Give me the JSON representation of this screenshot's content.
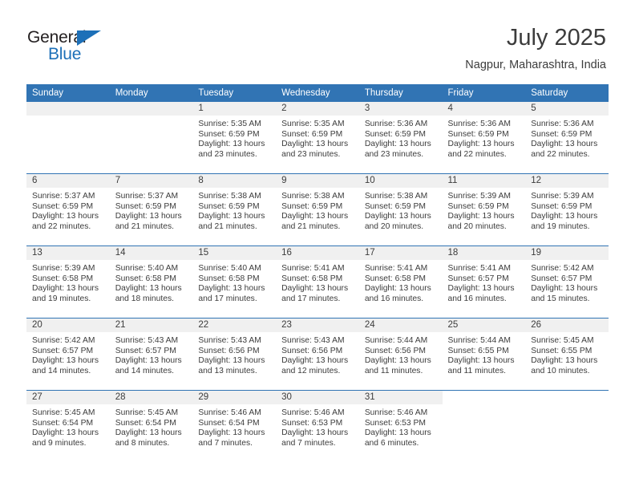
{
  "brand": {
    "name_part1": "General",
    "name_part2": "Blue",
    "triangle_color": "#1d70b8",
    "text_color": "#231f20"
  },
  "header": {
    "title": "July 2025",
    "subtitle": "Nagpur, Maharashtra, India"
  },
  "theme": {
    "header_bg": "#3174b4",
    "header_text": "#ffffff",
    "daynum_band": "#f0f0f0",
    "body_text": "#3c3c3c",
    "row_divider": "#3174b4"
  },
  "weekday_headers": [
    "Sunday",
    "Monday",
    "Tuesday",
    "Wednesday",
    "Thursday",
    "Friday",
    "Saturday"
  ],
  "weeks": [
    [
      {
        "day": "",
        "lines": []
      },
      {
        "day": "",
        "lines": []
      },
      {
        "day": "1",
        "lines": [
          "Sunrise: 5:35 AM",
          "Sunset: 6:59 PM",
          "Daylight: 13 hours",
          "and 23 minutes."
        ]
      },
      {
        "day": "2",
        "lines": [
          "Sunrise: 5:35 AM",
          "Sunset: 6:59 PM",
          "Daylight: 13 hours",
          "and 23 minutes."
        ]
      },
      {
        "day": "3",
        "lines": [
          "Sunrise: 5:36 AM",
          "Sunset: 6:59 PM",
          "Daylight: 13 hours",
          "and 23 minutes."
        ]
      },
      {
        "day": "4",
        "lines": [
          "Sunrise: 5:36 AM",
          "Sunset: 6:59 PM",
          "Daylight: 13 hours",
          "and 22 minutes."
        ]
      },
      {
        "day": "5",
        "lines": [
          "Sunrise: 5:36 AM",
          "Sunset: 6:59 PM",
          "Daylight: 13 hours",
          "and 22 minutes."
        ]
      }
    ],
    [
      {
        "day": "6",
        "lines": [
          "Sunrise: 5:37 AM",
          "Sunset: 6:59 PM",
          "Daylight: 13 hours",
          "and 22 minutes."
        ]
      },
      {
        "day": "7",
        "lines": [
          "Sunrise: 5:37 AM",
          "Sunset: 6:59 PM",
          "Daylight: 13 hours",
          "and 21 minutes."
        ]
      },
      {
        "day": "8",
        "lines": [
          "Sunrise: 5:38 AM",
          "Sunset: 6:59 PM",
          "Daylight: 13 hours",
          "and 21 minutes."
        ]
      },
      {
        "day": "9",
        "lines": [
          "Sunrise: 5:38 AM",
          "Sunset: 6:59 PM",
          "Daylight: 13 hours",
          "and 21 minutes."
        ]
      },
      {
        "day": "10",
        "lines": [
          "Sunrise: 5:38 AM",
          "Sunset: 6:59 PM",
          "Daylight: 13 hours",
          "and 20 minutes."
        ]
      },
      {
        "day": "11",
        "lines": [
          "Sunrise: 5:39 AM",
          "Sunset: 6:59 PM",
          "Daylight: 13 hours",
          "and 20 minutes."
        ]
      },
      {
        "day": "12",
        "lines": [
          "Sunrise: 5:39 AM",
          "Sunset: 6:59 PM",
          "Daylight: 13 hours",
          "and 19 minutes."
        ]
      }
    ],
    [
      {
        "day": "13",
        "lines": [
          "Sunrise: 5:39 AM",
          "Sunset: 6:58 PM",
          "Daylight: 13 hours",
          "and 19 minutes."
        ]
      },
      {
        "day": "14",
        "lines": [
          "Sunrise: 5:40 AM",
          "Sunset: 6:58 PM",
          "Daylight: 13 hours",
          "and 18 minutes."
        ]
      },
      {
        "day": "15",
        "lines": [
          "Sunrise: 5:40 AM",
          "Sunset: 6:58 PM",
          "Daylight: 13 hours",
          "and 17 minutes."
        ]
      },
      {
        "day": "16",
        "lines": [
          "Sunrise: 5:41 AM",
          "Sunset: 6:58 PM",
          "Daylight: 13 hours",
          "and 17 minutes."
        ]
      },
      {
        "day": "17",
        "lines": [
          "Sunrise: 5:41 AM",
          "Sunset: 6:58 PM",
          "Daylight: 13 hours",
          "and 16 minutes."
        ]
      },
      {
        "day": "18",
        "lines": [
          "Sunrise: 5:41 AM",
          "Sunset: 6:57 PM",
          "Daylight: 13 hours",
          "and 16 minutes."
        ]
      },
      {
        "day": "19",
        "lines": [
          "Sunrise: 5:42 AM",
          "Sunset: 6:57 PM",
          "Daylight: 13 hours",
          "and 15 minutes."
        ]
      }
    ],
    [
      {
        "day": "20",
        "lines": [
          "Sunrise: 5:42 AM",
          "Sunset: 6:57 PM",
          "Daylight: 13 hours",
          "and 14 minutes."
        ]
      },
      {
        "day": "21",
        "lines": [
          "Sunrise: 5:43 AM",
          "Sunset: 6:57 PM",
          "Daylight: 13 hours",
          "and 14 minutes."
        ]
      },
      {
        "day": "22",
        "lines": [
          "Sunrise: 5:43 AM",
          "Sunset: 6:56 PM",
          "Daylight: 13 hours",
          "and 13 minutes."
        ]
      },
      {
        "day": "23",
        "lines": [
          "Sunrise: 5:43 AM",
          "Sunset: 6:56 PM",
          "Daylight: 13 hours",
          "and 12 minutes."
        ]
      },
      {
        "day": "24",
        "lines": [
          "Sunrise: 5:44 AM",
          "Sunset: 6:56 PM",
          "Daylight: 13 hours",
          "and 11 minutes."
        ]
      },
      {
        "day": "25",
        "lines": [
          "Sunrise: 5:44 AM",
          "Sunset: 6:55 PM",
          "Daylight: 13 hours",
          "and 11 minutes."
        ]
      },
      {
        "day": "26",
        "lines": [
          "Sunrise: 5:45 AM",
          "Sunset: 6:55 PM",
          "Daylight: 13 hours",
          "and 10 minutes."
        ]
      }
    ],
    [
      {
        "day": "27",
        "lines": [
          "Sunrise: 5:45 AM",
          "Sunset: 6:54 PM",
          "Daylight: 13 hours",
          "and 9 minutes."
        ]
      },
      {
        "day": "28",
        "lines": [
          "Sunrise: 5:45 AM",
          "Sunset: 6:54 PM",
          "Daylight: 13 hours",
          "and 8 minutes."
        ]
      },
      {
        "day": "29",
        "lines": [
          "Sunrise: 5:46 AM",
          "Sunset: 6:54 PM",
          "Daylight: 13 hours",
          "and 7 minutes."
        ]
      },
      {
        "day": "30",
        "lines": [
          "Sunrise: 5:46 AM",
          "Sunset: 6:53 PM",
          "Daylight: 13 hours",
          "and 7 minutes."
        ]
      },
      {
        "day": "31",
        "lines": [
          "Sunrise: 5:46 AM",
          "Sunset: 6:53 PM",
          "Daylight: 13 hours",
          "and 6 minutes."
        ]
      },
      {
        "day": "",
        "lines": []
      },
      {
        "day": "",
        "lines": []
      }
    ]
  ]
}
